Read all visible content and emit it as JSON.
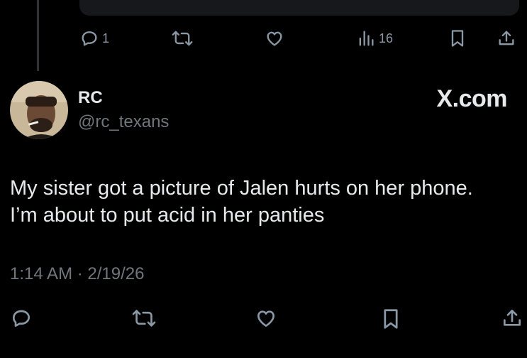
{
  "top_actions": {
    "replies": "1",
    "views": "16"
  },
  "author": {
    "display_name": "RC",
    "handle": "@rc_texans"
  },
  "watermark": "X.com",
  "tweet": {
    "lines": [
      "My sister got a picture of Jalen hurts on her phone.",
      "I’m about to put acid in her panties"
    ],
    "timestamp": "1:14 AM · 2/19/26"
  },
  "icons": {
    "top": [
      "reply-icon",
      "retweet-icon",
      "like-icon",
      "views-icon",
      "bookmark-icon",
      "share-icon"
    ],
    "bottom": [
      "reply-icon",
      "retweet-icon",
      "like-icon",
      "bookmark-icon",
      "share-icon"
    ]
  },
  "colors": {
    "background": "#000000",
    "text": "#e7e9ea",
    "secondary_text": "#71767b",
    "icon": "#8b98a5"
  }
}
